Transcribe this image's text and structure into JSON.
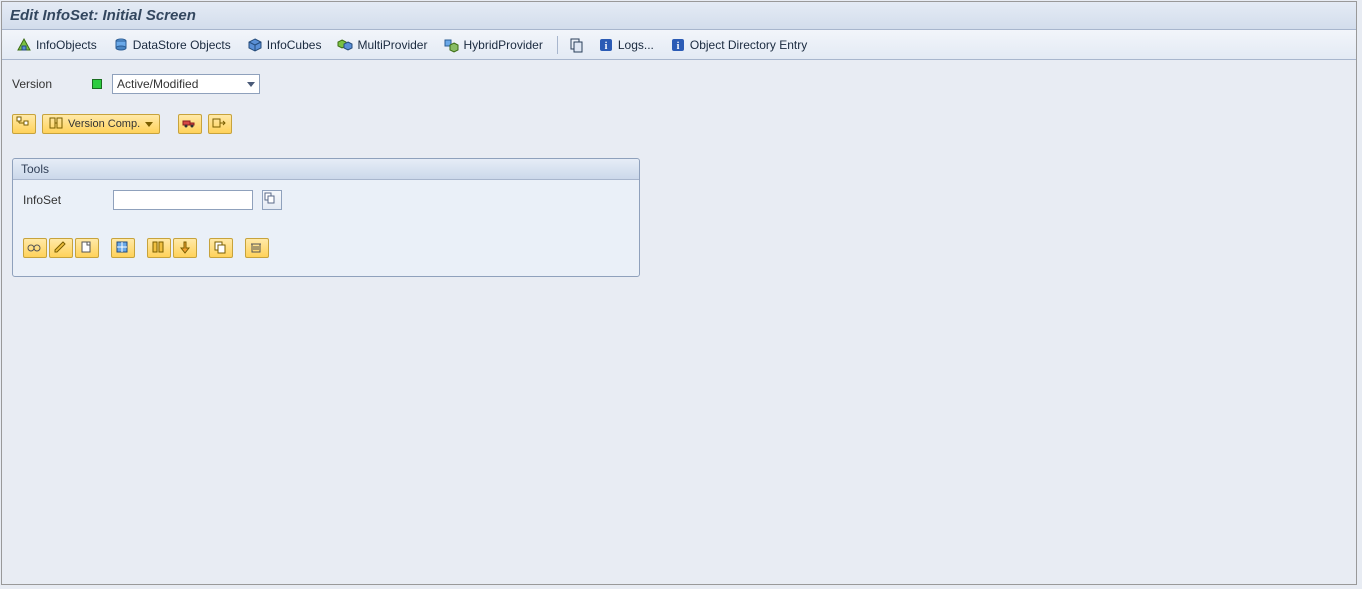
{
  "title": "Edit InfoSet: Initial Screen",
  "appToolbar": {
    "infoObjects": "InfoObjects",
    "dataStore": "DataStore Objects",
    "infoCubes": "InfoCubes",
    "multiProvider": "MultiProvider",
    "hybridProvider": "HybridProvider",
    "logs": "Logs...",
    "objDirEntry": "Object Directory Entry"
  },
  "version": {
    "label": "Version",
    "value": "Active/Modified"
  },
  "miniToolbar": {
    "versionCompare": "Version Comp."
  },
  "panel": {
    "title": "Tools",
    "infoset": {
      "label": "InfoSet",
      "value": ""
    }
  }
}
